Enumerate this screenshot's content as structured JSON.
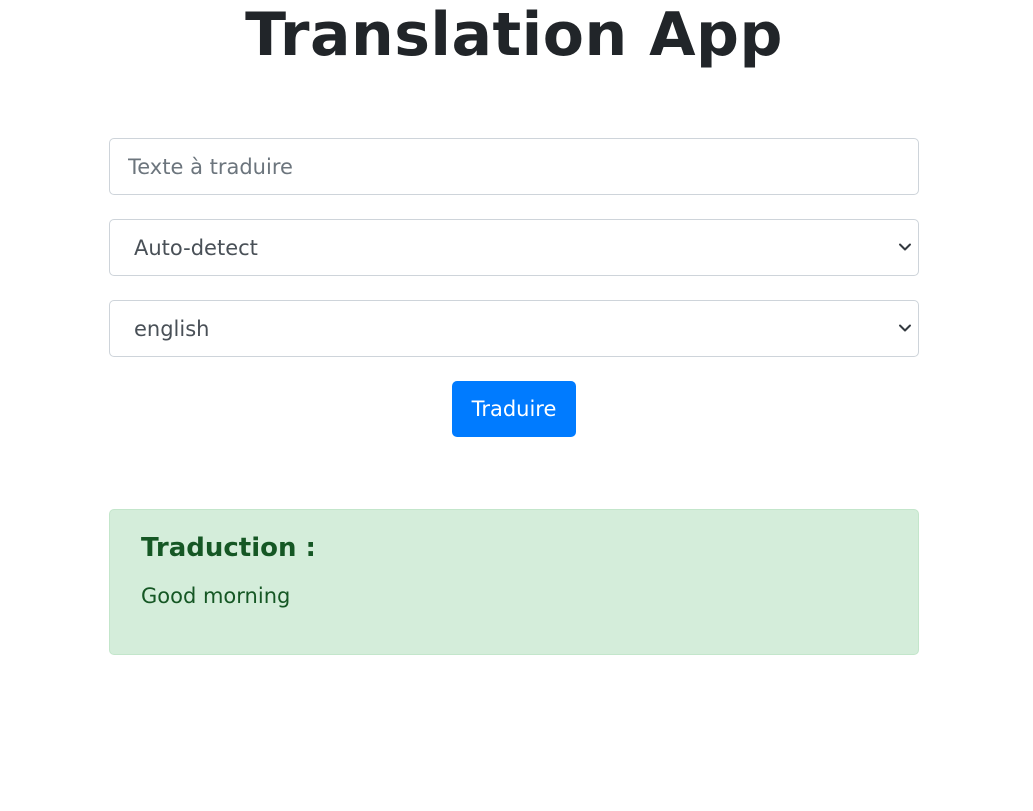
{
  "app": {
    "title": "Translation App"
  },
  "form": {
    "text_input": {
      "placeholder": "Texte à traduire",
      "value": ""
    },
    "source_language": {
      "selected": "Auto-detect"
    },
    "target_language": {
      "selected": "english"
    },
    "translate_button_label": "Traduire"
  },
  "result": {
    "heading": "Traduction :",
    "text": "Good morning"
  },
  "icons": {
    "select_chevron": "chevron-down-icon"
  },
  "colors": {
    "primary": "#007bff",
    "success_bg": "#d4edda",
    "success_border": "#c3e6cb",
    "success_text": "#155724",
    "title_text": "#212529"
  }
}
